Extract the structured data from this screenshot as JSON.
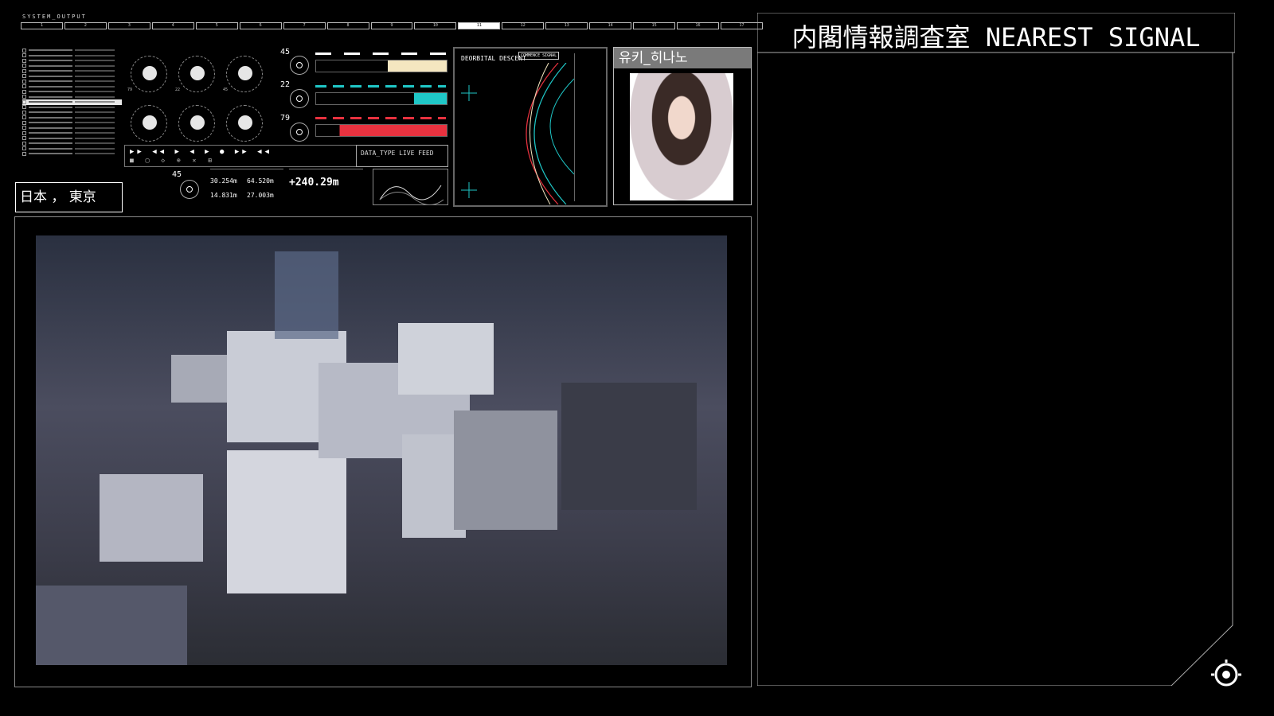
{
  "header": {
    "system_label": "SYSTEM_OUTPUT",
    "segments": [
      "1",
      "2",
      "3",
      "4",
      "5",
      "6",
      "7",
      "8",
      "9",
      "10",
      "11",
      "12",
      "13",
      "14",
      "15",
      "16",
      "17"
    ],
    "active_segment_index": 10
  },
  "list_panel": {
    "rows": 21,
    "highlighted_index": 10
  },
  "location": {
    "text": "日本 ， 東京"
  },
  "gauges": {
    "left_numbers": [
      "79",
      "22",
      "45"
    ],
    "dial_numbers": [
      "45",
      "22",
      "79"
    ]
  },
  "controls": {
    "feed_label": "DATA_TYPE LIVE FEED"
  },
  "readouts": {
    "dial_number": "45",
    "values": [
      "30.254m",
      "64.520m",
      "14.831m",
      "27.003m"
    ],
    "big_value": "+240.29m"
  },
  "orbit": {
    "title": "DEORBITAL DESCENT",
    "tag": "COMMENCE SIGNAL"
  },
  "portrait": {
    "name": "유키_히나노"
  },
  "signal_panel": {
    "title": "内閣情報調査室 NEAREST SIGNAL"
  },
  "colors": {
    "accent_cyan": "#1fc7c7",
    "accent_red": "#e8323f",
    "accent_amber": "#f4e6c0"
  }
}
